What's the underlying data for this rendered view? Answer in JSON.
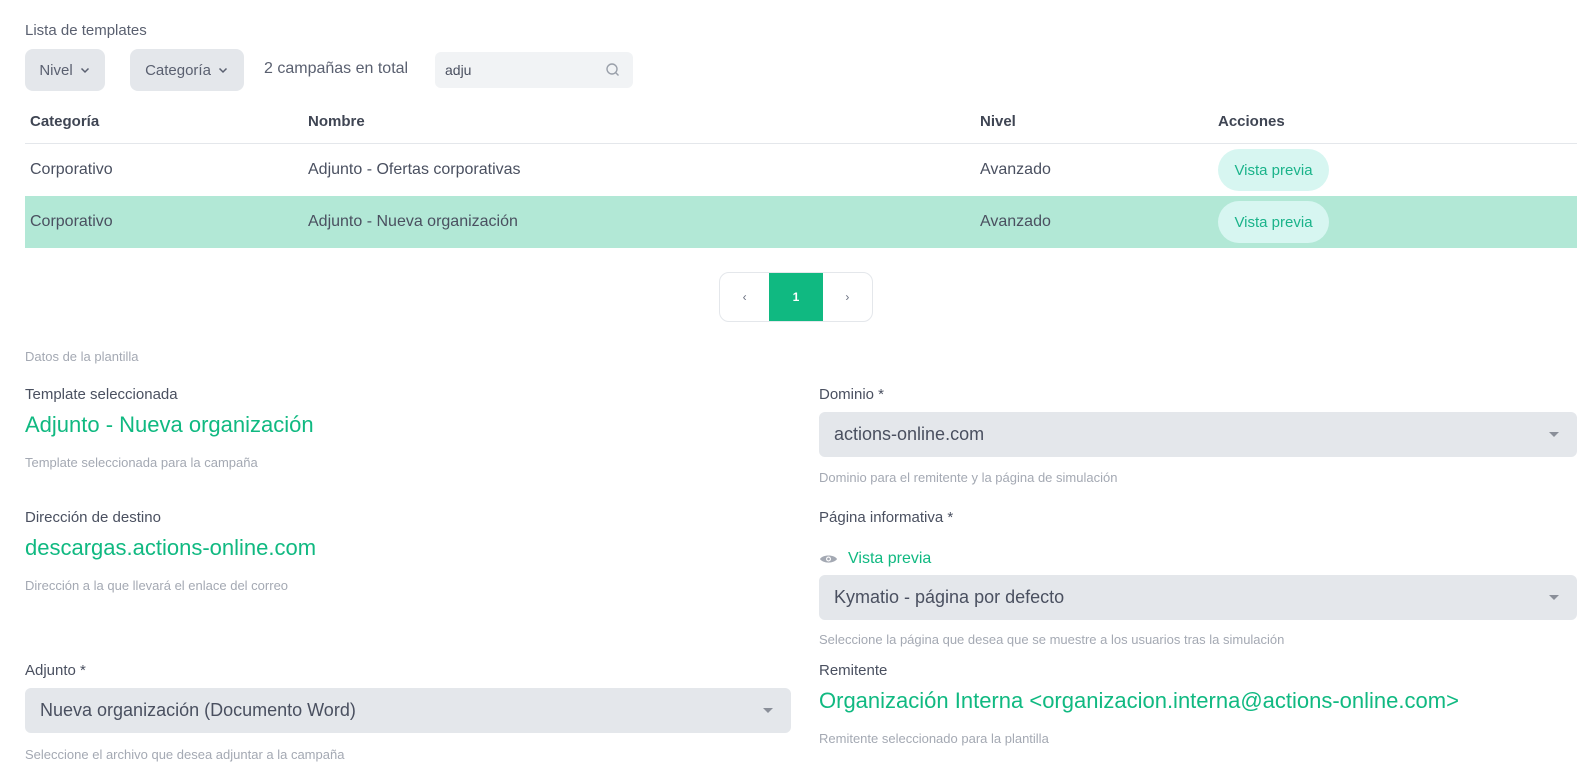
{
  "list": {
    "title": "Lista de templates",
    "filters": {
      "nivel": "Nivel",
      "categoria": "Categoría"
    },
    "total_text": "2 campañas en total",
    "search_value": "adju"
  },
  "table": {
    "headers": [
      "Categoría",
      "Nombre",
      "Nivel",
      "Acciones"
    ],
    "rows": [
      {
        "categoria": "Corporativo",
        "nombre": "Adjunto - Ofertas corporativas",
        "nivel": "Avanzado",
        "accion": "Vista previa",
        "selected": false
      },
      {
        "categoria": "Corporativo",
        "nombre": "Adjunto - Nueva organización",
        "nivel": "Avanzado",
        "accion": "Vista previa",
        "selected": true
      }
    ]
  },
  "pagination": {
    "prev": "‹",
    "current": "1",
    "next": "›"
  },
  "details": {
    "section_label": "Datos de la plantilla",
    "template": {
      "label": "Template seleccionada",
      "value": "Adjunto - Nueva organización",
      "help": "Template seleccionada para la campaña"
    },
    "dominio": {
      "label": "Dominio *",
      "value": "actions-online.com",
      "help": "Dominio para el remitente y la página de simulación"
    },
    "destino": {
      "label": "Dirección de destino",
      "value": "descargas.actions-online.com",
      "help": "Dirección a la que llevará el enlace del correo"
    },
    "pagina": {
      "label": "Página informativa *",
      "preview_label": "Vista previa",
      "value": "Kymatio - página por defecto",
      "help": "Seleccione la página que desea que se muestre a los usuarios tras la simulación"
    },
    "adjunto": {
      "label": "Adjunto *",
      "value": "Nueva organización (Documento Word)",
      "help": "Seleccione el archivo que desea adjuntar a la campaña"
    },
    "remitente": {
      "label": "Remitente",
      "value": "Organización Interna <organizacion.interna@actions-online.com>",
      "help": "Remitente seleccionado para la plantilla"
    }
  },
  "colors": {
    "accent": "#10b981",
    "selected_row": "#b2e8d6",
    "control_bg": "#e4e7eb"
  }
}
